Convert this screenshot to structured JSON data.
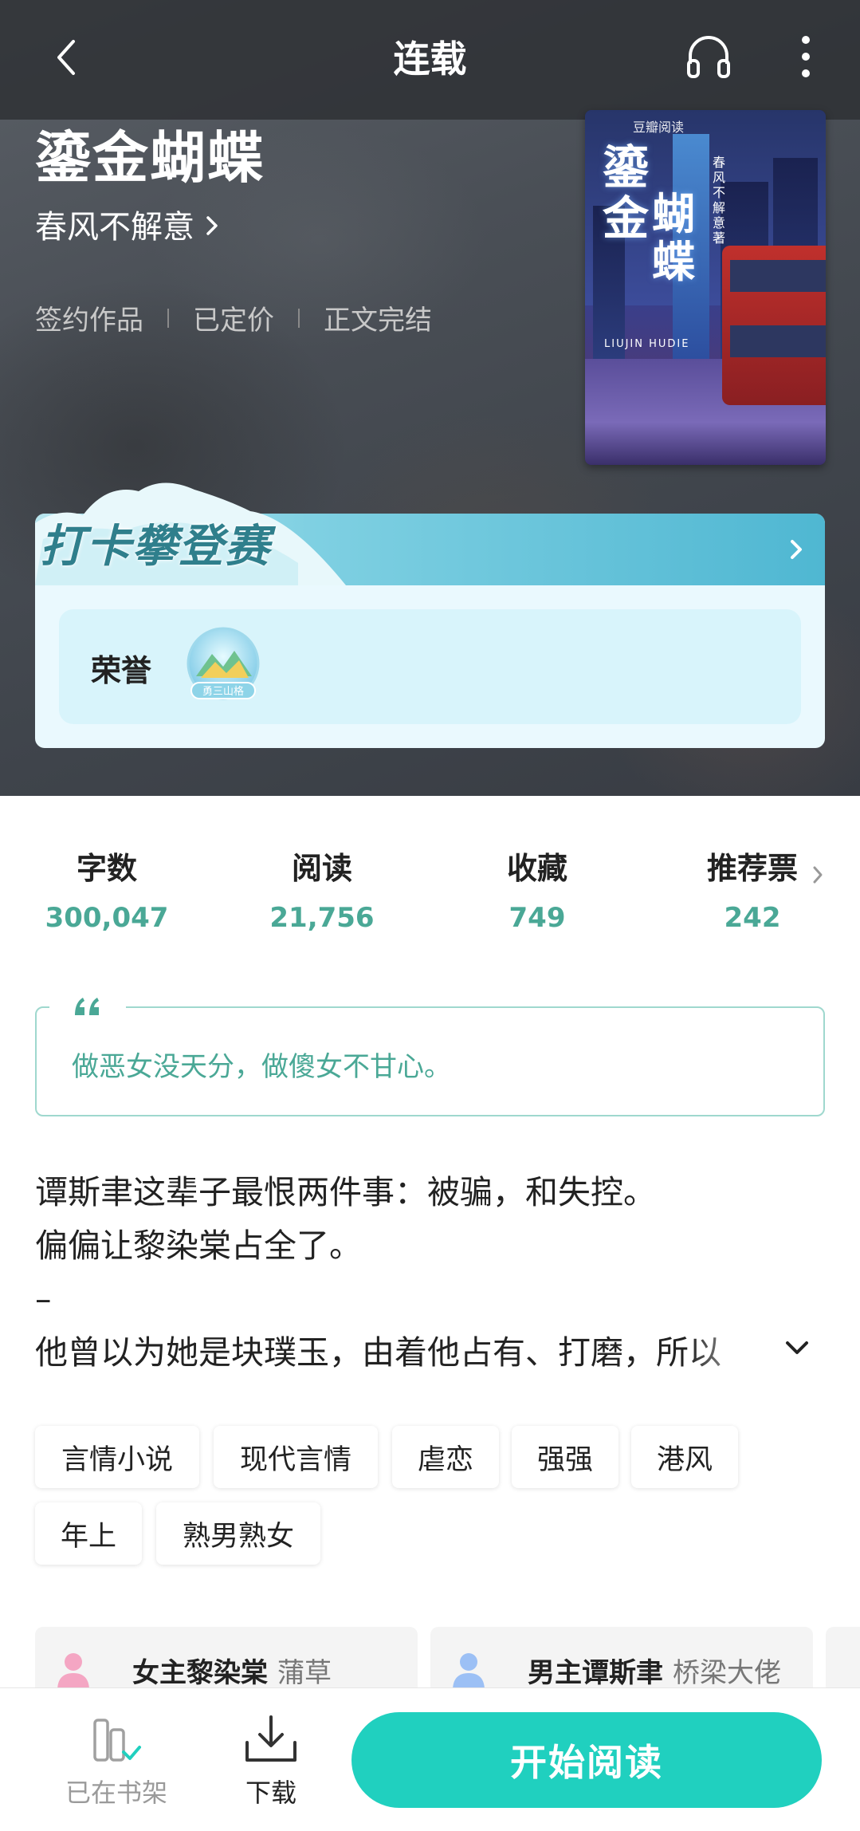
{
  "nav": {
    "title": "连载"
  },
  "book": {
    "title": "鎏金蝴蝶",
    "author": "春风不解意",
    "meta": [
      "签约作品",
      "已定价",
      "正文完结"
    ],
    "cover": {
      "publisher": "豆瓣阅读",
      "title_line1": "鎏",
      "title_line1b": "金",
      "title_line2": "蝴蝶",
      "author": "春风不解意著",
      "latin": "LIUJIN HUDIE"
    }
  },
  "checkin": {
    "title": "打卡攀登赛",
    "honor_label": "荣誉",
    "badge_text": "勇三山格"
  },
  "stats": [
    {
      "label": "字数",
      "value": "300,047"
    },
    {
      "label": "阅读",
      "value": "21,756"
    },
    {
      "label": "收藏",
      "value": "749"
    },
    {
      "label": "推荐票",
      "value": "242"
    }
  ],
  "quote": {
    "mark": "❝",
    "text": "做恶女没天分，做傻女不甘心。"
  },
  "synopsis": {
    "lines": [
      "谭斯聿这辈子最恨两件事：被骗，和失控。",
      "偏偏让黎染棠占全了。",
      "–",
      "他曾以为她是块璞玉，由着他占有、打磨，所以"
    ]
  },
  "tags": [
    "言情小说",
    "现代言情",
    "虐恋",
    "强强",
    "港风",
    "年上",
    "熟男熟女"
  ],
  "roles": [
    {
      "name": "女主黎染棠",
      "desc": "蒲草",
      "color": "#f4a6c3"
    },
    {
      "name": "男主谭斯聿",
      "desc": "桥梁大佬",
      "color": "#9cc0f5"
    }
  ],
  "bottom": {
    "shelf_label": "已在书架",
    "download_label": "下载",
    "read_label": "开始阅读"
  },
  "colors": {
    "accent": "#20d0bf",
    "stat_value": "#4aa896"
  }
}
